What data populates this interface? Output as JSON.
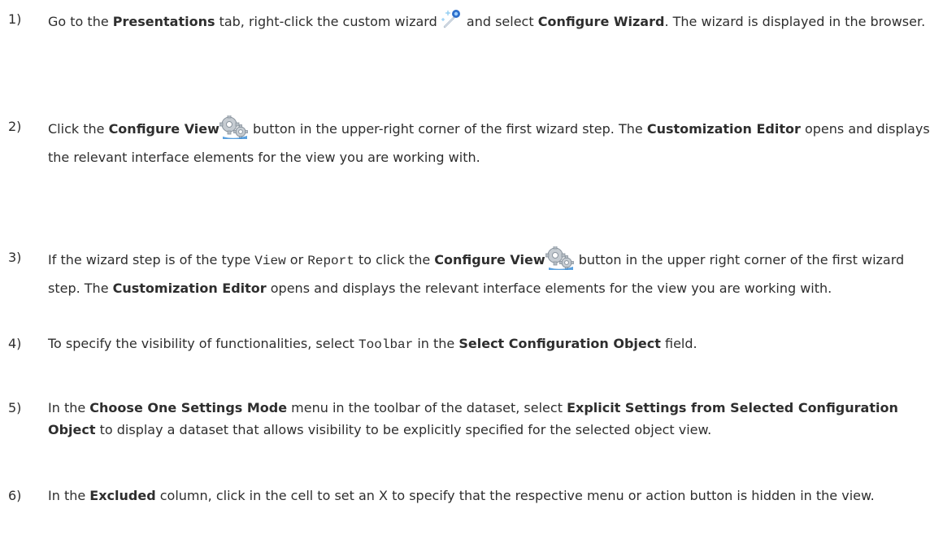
{
  "steps": [
    {
      "number": "1)",
      "parts": {
        "a": "Go to the ",
        "b1": "Presentations",
        "c": " tab, right-click the custom wizard ",
        "d": " and select ",
        "b2": "Configure Wizard",
        "e": ". The wizard is displayed in the browser."
      },
      "icon": "wizard-wand-icon"
    },
    {
      "number": "2)",
      "parts": {
        "a": "Click the ",
        "b1": "Configure View",
        "c": " button in the upper-right corner of the first wizard step. The ",
        "b2": "Customization Editor",
        "d": " opens and displays the relevant interface elements for the view you are working with."
      },
      "icon": "gear-icon"
    },
    {
      "number": "3)",
      "parts": {
        "a": "If the wizard step is of the type ",
        "code1": "View",
        "b": " or ",
        "code2": "Report",
        "c": " to click the ",
        "b1": "Configure View",
        "d": " button in the upper right corner of the first wizard step. The ",
        "b2": "Customization Editor",
        "e": " opens and displays the relevant interface elements for the view you are working with."
      },
      "icon": "gear-icon"
    },
    {
      "number": "4)",
      "parts": {
        "a": "To specify the visibility of functionalities, select ",
        "code1": "Toolbar",
        "b": " in the ",
        "b1": "Select Configuration Object",
        "c": " field."
      }
    },
    {
      "number": "5)",
      "parts": {
        "a": "In the ",
        "b1": "Choose One Settings Mode",
        "b": " menu in the toolbar of the dataset, select ",
        "b2": "Explicit Settings from Selected Configuration Object",
        "c": " to display a dataset that allows visibility to be explicitly specified for the selected object view."
      }
    },
    {
      "number": "6)",
      "parts": {
        "a": "In the ",
        "b1": "Excluded",
        "b": " column, click in the cell to set an X to specify that the respective menu or action button is hidden in the view."
      }
    }
  ]
}
